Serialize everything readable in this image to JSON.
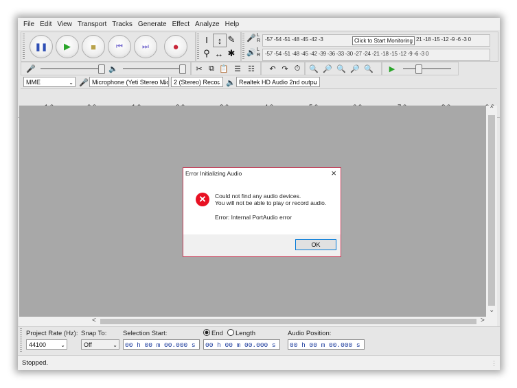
{
  "menu": [
    "File",
    "Edit",
    "View",
    "Transport",
    "Tracks",
    "Generate",
    "Effect",
    "Analyze",
    "Help"
  ],
  "meters": {
    "record_scale": "-57 -54 -51 -48 -45 -42 -3",
    "monitor_tip": "Click to Start Monitoring",
    "record_scale_tail": "21 -18 -15 -12 -9 -6 -3 0",
    "playback_scale": "-57 -54 -51 -48 -45 -42 -39 -36 -33 -30 -27 -24 -21 -18 -15 -12 -9 -6 -3 0",
    "channel_l": "L",
    "channel_r": "R"
  },
  "devices": {
    "host": "MME",
    "recording_device": "Microphone (Yeti Stereo Mic",
    "channels": "2 (Stereo) Recor",
    "playback_device": "Realtek HD Audio 2nd outpu"
  },
  "ruler": {
    "labels": [
      "- 1.0",
      "0.0",
      "1.0",
      "2.0",
      "3.0",
      "4.0",
      "5.0",
      "6.0",
      "7.0",
      "8.0",
      "9.0"
    ]
  },
  "selection_toolbar": {
    "project_rate_label": "Project Rate (Hz):",
    "project_rate_value": "44100",
    "snap_to_label": "Snap To:",
    "snap_to_value": "Off",
    "selection_start_label": "Selection Start:",
    "end_label": "End",
    "length_label": "Length",
    "audio_position_label": "Audio Position:",
    "selection_start_value": "00 h 00 m 00.000 s",
    "selection_end_value": "00 h 00 m 00.000 s",
    "audio_position_value": "00 h 00 m 00.000 s"
  },
  "status": "Stopped.",
  "dialog": {
    "title": "Error Initializing Audio",
    "line1": "Could not find any audio devices.",
    "line2": "You will not be able to play or record audio.",
    "line3": "Error: Internal PortAudio error",
    "ok_label": "OK"
  }
}
